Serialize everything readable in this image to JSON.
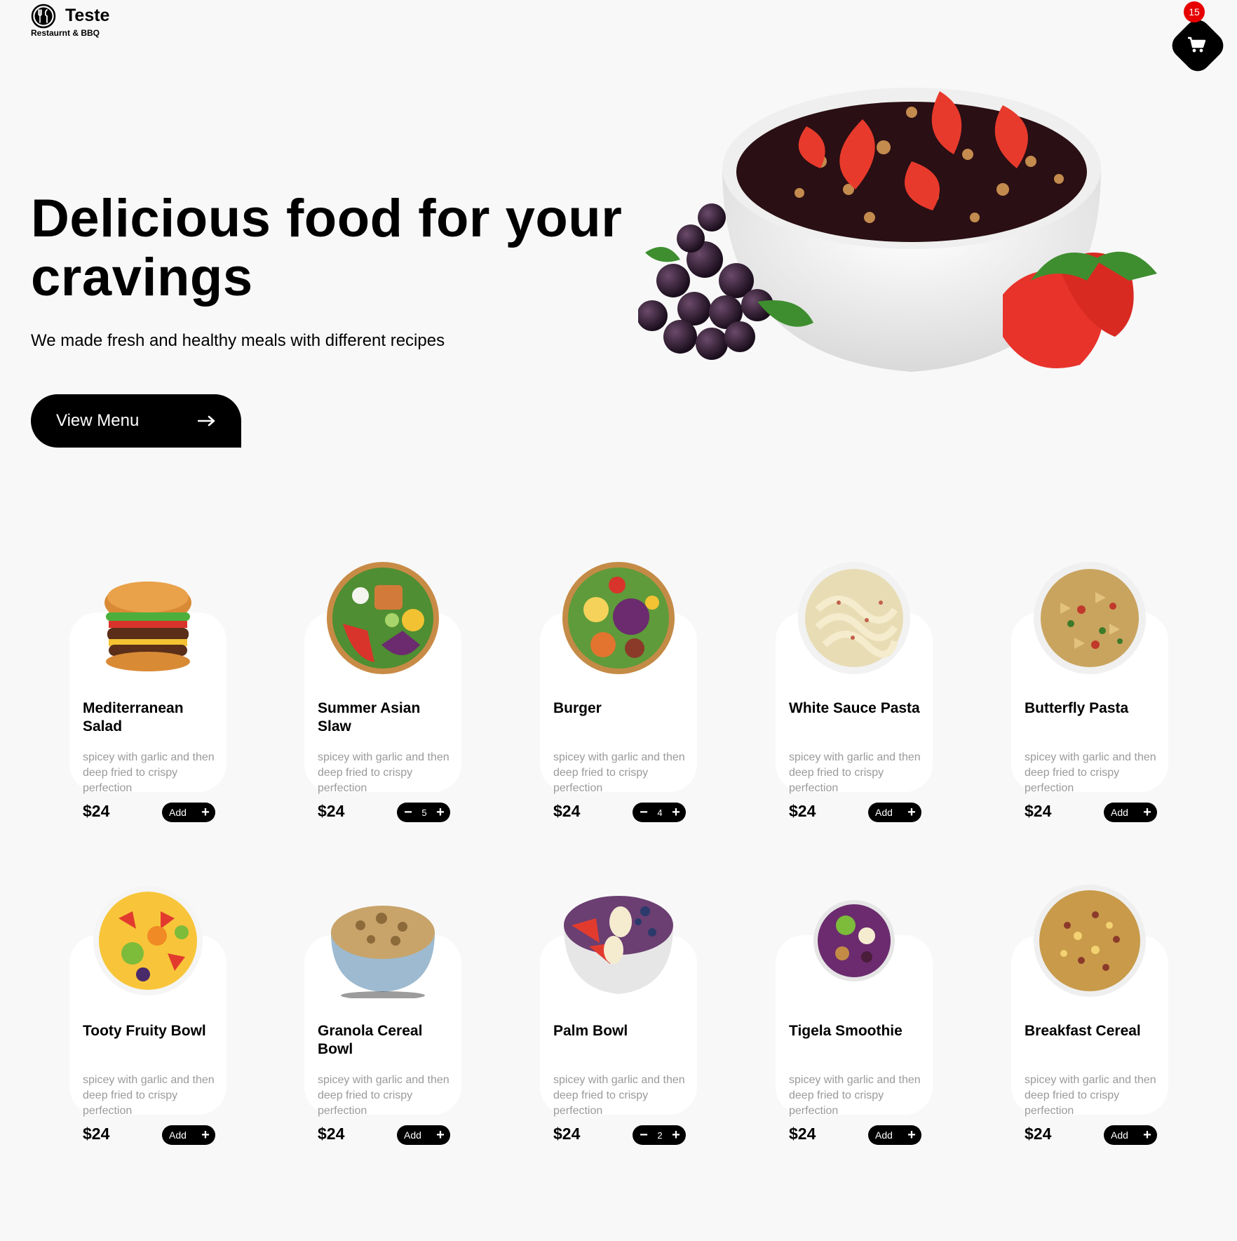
{
  "brand": {
    "name": "Teste",
    "tagline": "Restaurnt & BBQ"
  },
  "cart": {
    "count": "15"
  },
  "hero": {
    "title": "Delicious food for your cravings",
    "subtitle": "We made fresh and healthy meals with different recipes",
    "cta_label": "View Menu"
  },
  "menu": {
    "items": [
      {
        "name": "Mediterranean Salad",
        "desc": "spicey with garlic and then deep fried to crispy perfection",
        "price": "$24",
        "mode": "add",
        "add_label": "Add"
      },
      {
        "name": "Summer Asian Slaw",
        "desc": "spicey with garlic and then deep fried to crispy perfection",
        "price": "$24",
        "mode": "qty",
        "qty": "5"
      },
      {
        "name": "Burger",
        "desc": "spicey with garlic and then deep fried to crispy perfection",
        "price": "$24",
        "mode": "qty",
        "qty": "4"
      },
      {
        "name": "White Sauce Pasta",
        "desc": "spicey with garlic and then deep fried to crispy perfection",
        "price": "$24",
        "mode": "add",
        "add_label": "Add"
      },
      {
        "name": "Butterfly Pasta",
        "desc": "spicey with garlic and then deep fried to crispy perfection",
        "price": "$24",
        "mode": "add",
        "add_label": "Add"
      },
      {
        "name": "Tooty Fruity Bowl",
        "desc": "spicey with garlic and then deep fried to crispy perfection",
        "price": "$24",
        "mode": "add",
        "add_label": "Add"
      },
      {
        "name": "Granola Cereal Bowl",
        "desc": "spicey with garlic and then deep fried to crispy perfection",
        "price": "$24",
        "mode": "add",
        "add_label": "Add"
      },
      {
        "name": "Palm Bowl",
        "desc": "spicey with garlic and then deep fried to crispy perfection",
        "price": "$24",
        "mode": "qty",
        "qty": "2"
      },
      {
        "name": "Tigela Smoothie",
        "desc": "spicey with garlic and then deep fried to crispy perfection",
        "price": "$24",
        "mode": "add",
        "add_label": "Add"
      },
      {
        "name": "Breakfast Cereal",
        "desc": "spicey with garlic and then deep fried to crispy perfection",
        "price": "$24",
        "mode": "add",
        "add_label": "Add"
      }
    ]
  },
  "icons": {
    "logo": "fork-knife-icon",
    "cart": "shopping-cart-icon",
    "cta": "arrow-right-icon",
    "add": "plus-icon",
    "remove": "minus-icon"
  },
  "colors": {
    "accent": "#000000",
    "badge": "#e60000",
    "background": "#f8f8f8",
    "card": "#ffffff",
    "muted_text": "#9a9a9a"
  }
}
